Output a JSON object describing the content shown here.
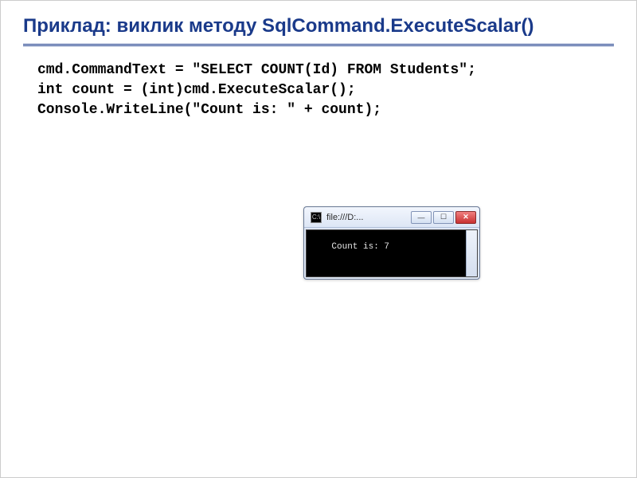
{
  "slide": {
    "title": "Приклад: виклик методу SqlCommand.ExecuteScalar()"
  },
  "code": {
    "line1": "cmd.CommandText = \"SELECT COUNT(Id) FROM Students\";",
    "line2": "int count = (int)cmd.ExecuteScalar();",
    "line3": "Console.WriteLine(\"Count is: \" + count);"
  },
  "console_window": {
    "title": "file:///D:...",
    "min_label": "—",
    "max_label": "☐",
    "close_label": "✕",
    "output": "Count is: 7"
  }
}
